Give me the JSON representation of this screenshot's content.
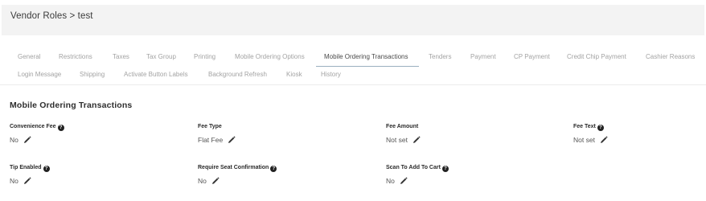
{
  "breadcrumb": {
    "title": "Vendor Roles > test"
  },
  "tabs": [
    {
      "label": "General"
    },
    {
      "label": "Restrictions"
    },
    {
      "label": "Taxes"
    },
    {
      "label": "Tax Group"
    },
    {
      "label": "Printing"
    },
    {
      "label": "Mobile Ordering Options"
    },
    {
      "label": "Mobile Ordering Transactions",
      "active": true
    },
    {
      "label": "Tenders"
    },
    {
      "label": "Payment"
    },
    {
      "label": "CP Payment"
    },
    {
      "label": "Credit Chip Payment"
    },
    {
      "label": "Cashier Reasons"
    },
    {
      "label": "Login Message"
    },
    {
      "label": "Shipping"
    },
    {
      "label": "Activate Button Labels"
    },
    {
      "label": "Background Refresh"
    },
    {
      "label": "Kiosk"
    },
    {
      "label": "History"
    }
  ],
  "section": {
    "title": "Mobile Ordering Transactions"
  },
  "fields": {
    "convenience_fee": {
      "label": "Convenience Fee",
      "value": "No",
      "help": true
    },
    "fee_type": {
      "label": "Fee Type",
      "value": "Flat Fee",
      "help": false
    },
    "fee_amount": {
      "label": "Fee Amount",
      "value": "Not set",
      "help": false
    },
    "fee_text": {
      "label": "Fee Text",
      "value": "Not set",
      "help": true
    },
    "tip_enabled": {
      "label": "Tip Enabled",
      "value": "No",
      "help": true
    },
    "require_seat_confirmation": {
      "label": "Require Seat Confirmation",
      "value": "No",
      "help": true
    },
    "scan_to_add_to_cart": {
      "label": "Scan To Add To Cart",
      "value": "No",
      "help": true
    }
  },
  "icons": {
    "help": "question-circle-icon",
    "edit": "pencil-icon"
  },
  "colors": {
    "header_bg": "#f3f3f3",
    "tab_active_underline": "#9ab0c0",
    "tab_inactive": "#a3a3a3"
  }
}
